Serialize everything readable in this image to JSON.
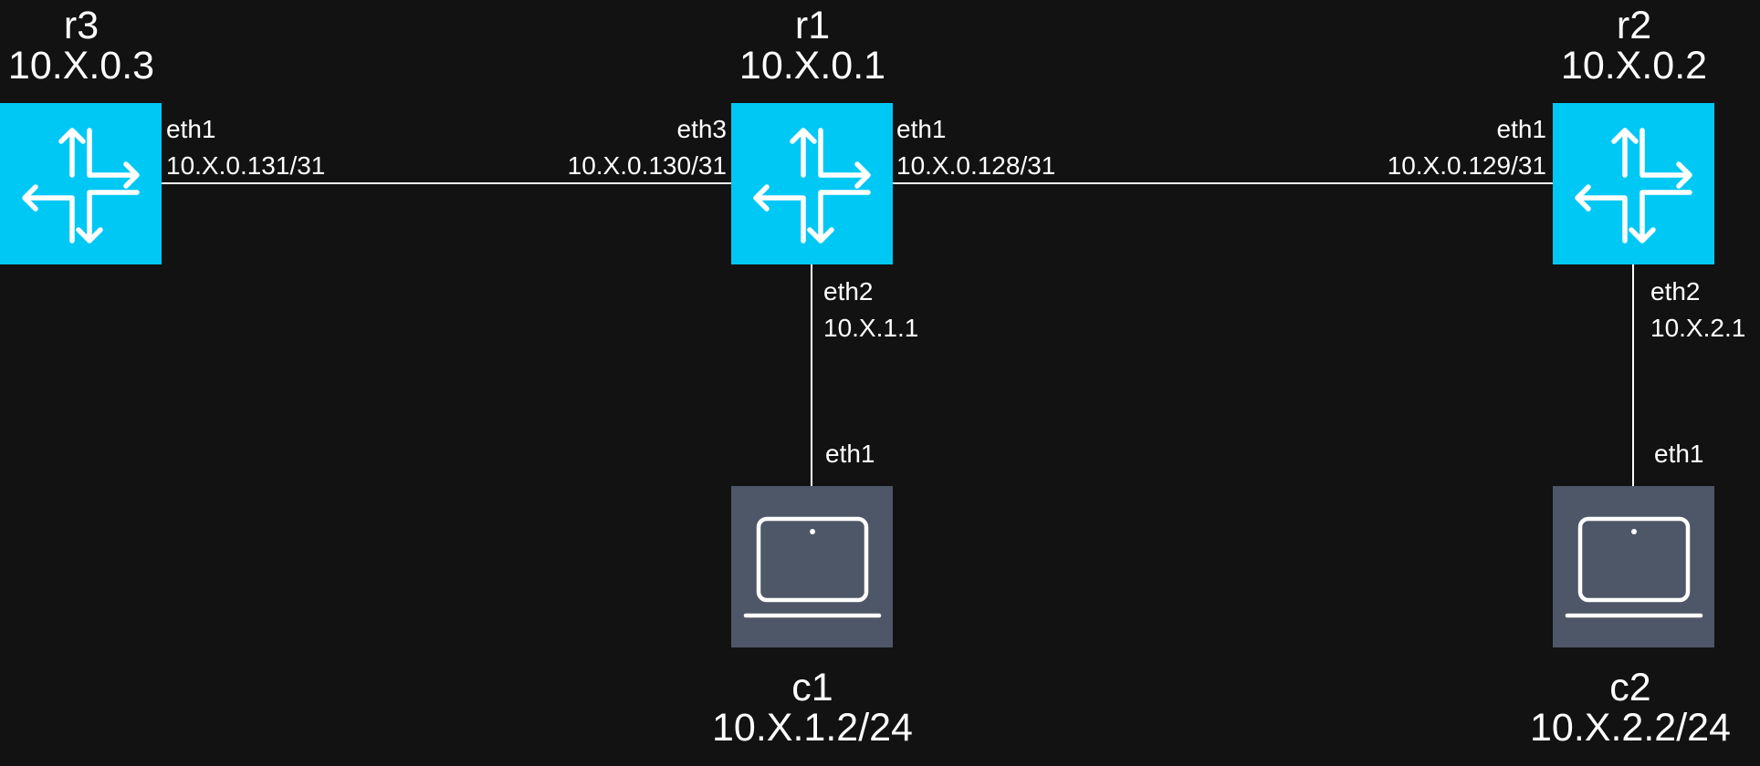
{
  "colors": {
    "background": "#121212",
    "router": "#00c8f5",
    "client": "#4e5767",
    "link": "#ffffff",
    "text": "#ffffff"
  },
  "nodes": {
    "r3": {
      "name": "r3",
      "address": "10.X.0.3",
      "icon": "router-icon"
    },
    "r1": {
      "name": "r1",
      "address": "10.X.0.1",
      "icon": "router-icon"
    },
    "r2": {
      "name": "r2",
      "address": "10.X.0.2",
      "icon": "router-icon"
    },
    "c1": {
      "name": "c1",
      "address": "10.X.1.2/24",
      "icon": "laptop-icon"
    },
    "c2": {
      "name": "c2",
      "address": "10.X.2.2/24",
      "icon": "laptop-icon"
    }
  },
  "interfaces": {
    "r3_eth1": {
      "name": "eth1",
      "address": "10.X.0.131/31"
    },
    "r1_eth3": {
      "name": "eth3",
      "address": "10.X.0.130/31"
    },
    "r1_eth1": {
      "name": "eth1",
      "address": "10.X.0.128/31"
    },
    "r2_eth1": {
      "name": "eth1",
      "address": "10.X.0.129/31"
    },
    "r1_eth2": {
      "name": "eth2",
      "address": "10.X.1.1"
    },
    "r2_eth2": {
      "name": "eth2",
      "address": "10.X.2.1"
    },
    "c1_eth1": {
      "name": "eth1"
    },
    "c2_eth1": {
      "name": "eth1"
    }
  }
}
